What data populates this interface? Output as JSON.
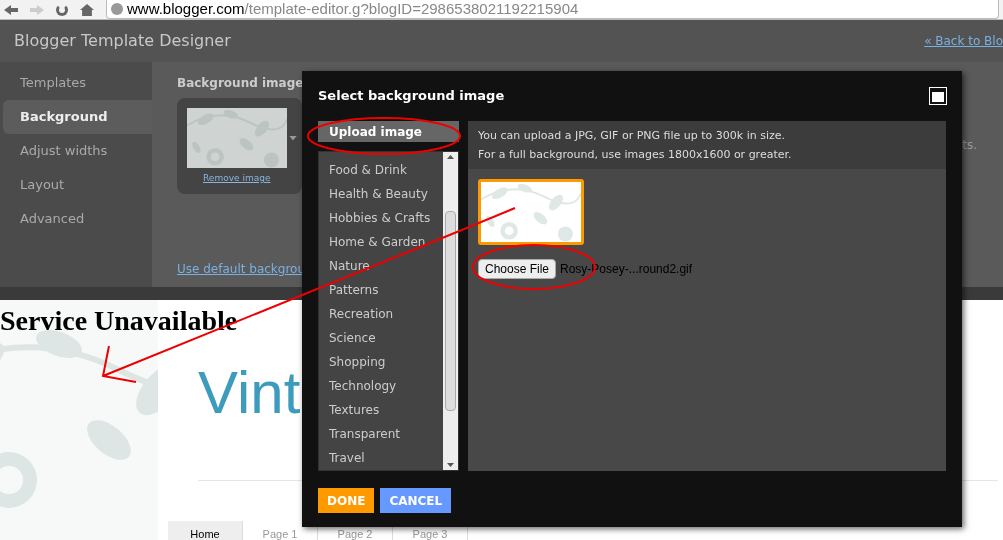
{
  "browser": {
    "address_domain": "www.blogger.com",
    "address_path": "/template-editor.g?blogID=2986538021192215904"
  },
  "header": {
    "title": "Blogger Template Designer",
    "back_link": "« Back to Blo"
  },
  "sidebar": {
    "items": [
      {
        "label": "Templates",
        "selected": false
      },
      {
        "label": "Background",
        "selected": true
      },
      {
        "label": "Adjust widths",
        "selected": false
      },
      {
        "label": "Layout",
        "selected": false
      },
      {
        "label": "Advanced",
        "selected": false
      }
    ]
  },
  "content": {
    "section_label": "Background image",
    "remove_link": "Remove image",
    "default_link": "Use default backgrou",
    "hidden_text": "ts."
  },
  "preview": {
    "error_heading": "Service Unavailable",
    "blog_title": "Vint",
    "tabs": [
      {
        "label": "Home",
        "selected": true
      },
      {
        "label": "Page 1",
        "selected": false
      },
      {
        "label": "Page 2",
        "selected": false
      },
      {
        "label": "Page 3",
        "selected": false
      }
    ]
  },
  "dialog": {
    "title": "Select background image",
    "upload_tab": {
      "label": "Upload image",
      "selected": true
    },
    "categories": [
      {
        "label": "Food & Drink",
        "selected": false
      },
      {
        "label": "Health & Beauty",
        "selected": false
      },
      {
        "label": "Hobbies & Crafts",
        "selected": false
      },
      {
        "label": "Home & Garden",
        "selected": false
      },
      {
        "label": "Nature",
        "selected": false
      },
      {
        "label": "Patterns",
        "selected": false
      },
      {
        "label": "Recreation",
        "selected": false
      },
      {
        "label": "Science",
        "selected": false
      },
      {
        "label": "Shopping",
        "selected": false
      },
      {
        "label": "Technology",
        "selected": false
      },
      {
        "label": "Textures",
        "selected": false
      },
      {
        "label": "Transparent",
        "selected": false
      },
      {
        "label": "Travel",
        "selected": false
      }
    ],
    "info_lines": [
      "You can upload a JPG, GIF or PNG file up to 300k in size.",
      "For a full background, use images 1800x1600 or greater."
    ],
    "choose_button": "Choose File",
    "file_name": "Rosy-Posey-...round2.gif",
    "buttons": [
      {
        "label": "DONE",
        "kind": "primary"
      },
      {
        "label": "CANCEL",
        "kind": "secondary"
      }
    ]
  }
}
